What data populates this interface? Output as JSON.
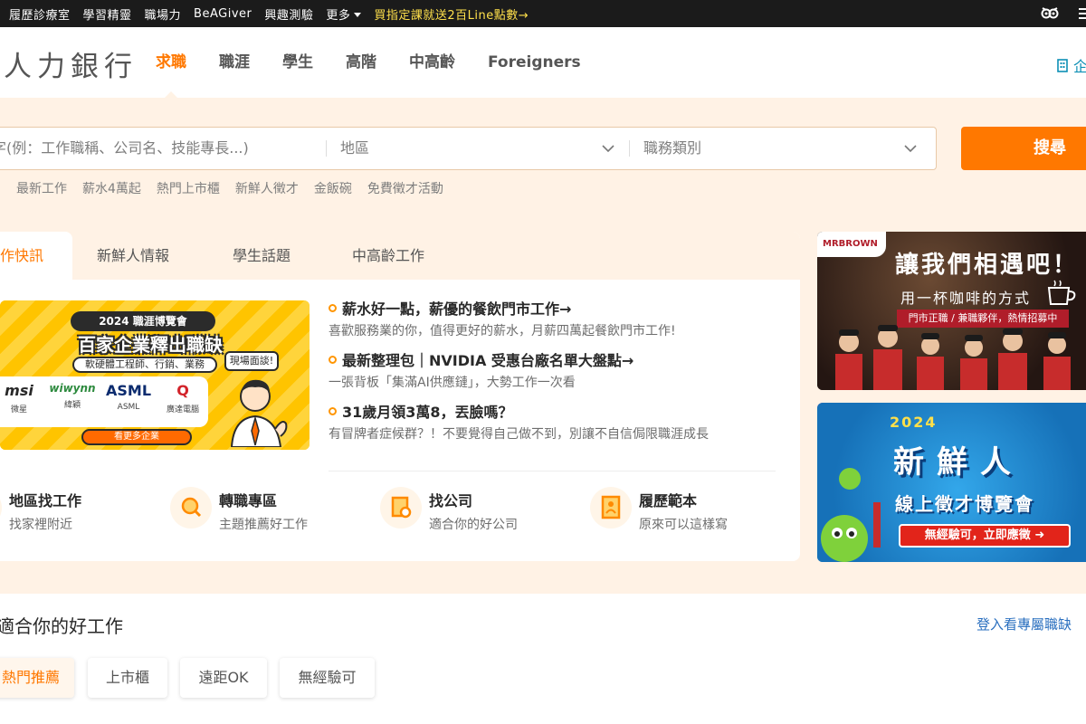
{
  "topbar": {
    "links": [
      "履歷診療室",
      "學習精靈",
      "職場力",
      "BeAGiver",
      "興趣測驗"
    ],
    "more": "更多",
    "promo": "買指定課就送2百Line點數→"
  },
  "header": {
    "logo": "人力銀行",
    "nav": [
      "求職",
      "職涯",
      "學生",
      "高階",
      "中高齡",
      "Foreigners"
    ],
    "business": "企"
  },
  "search": {
    "keyword_placeholder": "字(例：工作職稱、公司名、技能專長...)",
    "area_placeholder": "地區",
    "category_placeholder": "職務類別",
    "button": "搜尋",
    "hot_keywords": [
      "最新工作",
      "薪水4萬起",
      "熱門上市櫃",
      "新鮮人徵才",
      "金飯碗",
      "免費徵才活動"
    ]
  },
  "tabs": [
    "作快訊",
    "新鮮人情報",
    "學生話題",
    "中高齡工作"
  ],
  "banner": {
    "pill": "2024 職涯博覽會",
    "headline": "百家企業釋出職缺",
    "sub": "軟硬體工程師、行銷、業務",
    "bubble": "現場面談!",
    "logos": [
      {
        "mark": "msi",
        "caption": "微星"
      },
      {
        "mark": "wiwynn",
        "caption": "緯穎"
      },
      {
        "mark": "ASML",
        "caption": "ASML"
      },
      {
        "mark": "Q",
        "caption": "廣達電腦"
      }
    ],
    "button": "看更多企業"
  },
  "news": [
    {
      "title": "薪水好一點，薪優的餐飲門市工作→",
      "desc": "喜歡服務業的你，值得更好的薪水，月薪四萬起餐飲門市工作!"
    },
    {
      "title": "最新整理包｜NVIDIA 受惠台廠名單大盤點→",
      "desc": "一張背板「集滿AI供應鏈」，大勢工作一次看"
    },
    {
      "title": "31歲月領3萬8，丟臉嗎？",
      "desc": "有冒牌者症候群？！不要覺得自己做不到，別讓不自信侷限職涯成長"
    }
  ],
  "features": [
    {
      "title": "地區找工作",
      "sub": "找家裡附近"
    },
    {
      "title": "轉職專區",
      "sub": "主題推薦好工作"
    },
    {
      "title": "找公司",
      "sub": "適合你的好公司"
    },
    {
      "title": "履歷範本",
      "sub": "原來可以這樣寫"
    }
  ],
  "ad1": {
    "brand": "MRBROWN",
    "headline": "讓我們相遇吧！",
    "sub": "用一杯咖啡的方式",
    "ribbon": "門市正職 / 兼職夥伴，熱情招募中"
  },
  "ad2": {
    "year": "2024",
    "headline": "新鮮人",
    "sub": "線上徵才博覽會",
    "button": "無經驗可，立即應徵"
  },
  "jobs": {
    "title": "適合你的好工作",
    "login": "登入看專屬職缺",
    "chips": [
      "熱門推薦",
      "上市櫃",
      "遠距OK",
      "無經驗可"
    ]
  },
  "colors": {
    "accent": "#ff7800",
    "hero_bg": "#fff2e5",
    "link": "#2a6fbf"
  }
}
